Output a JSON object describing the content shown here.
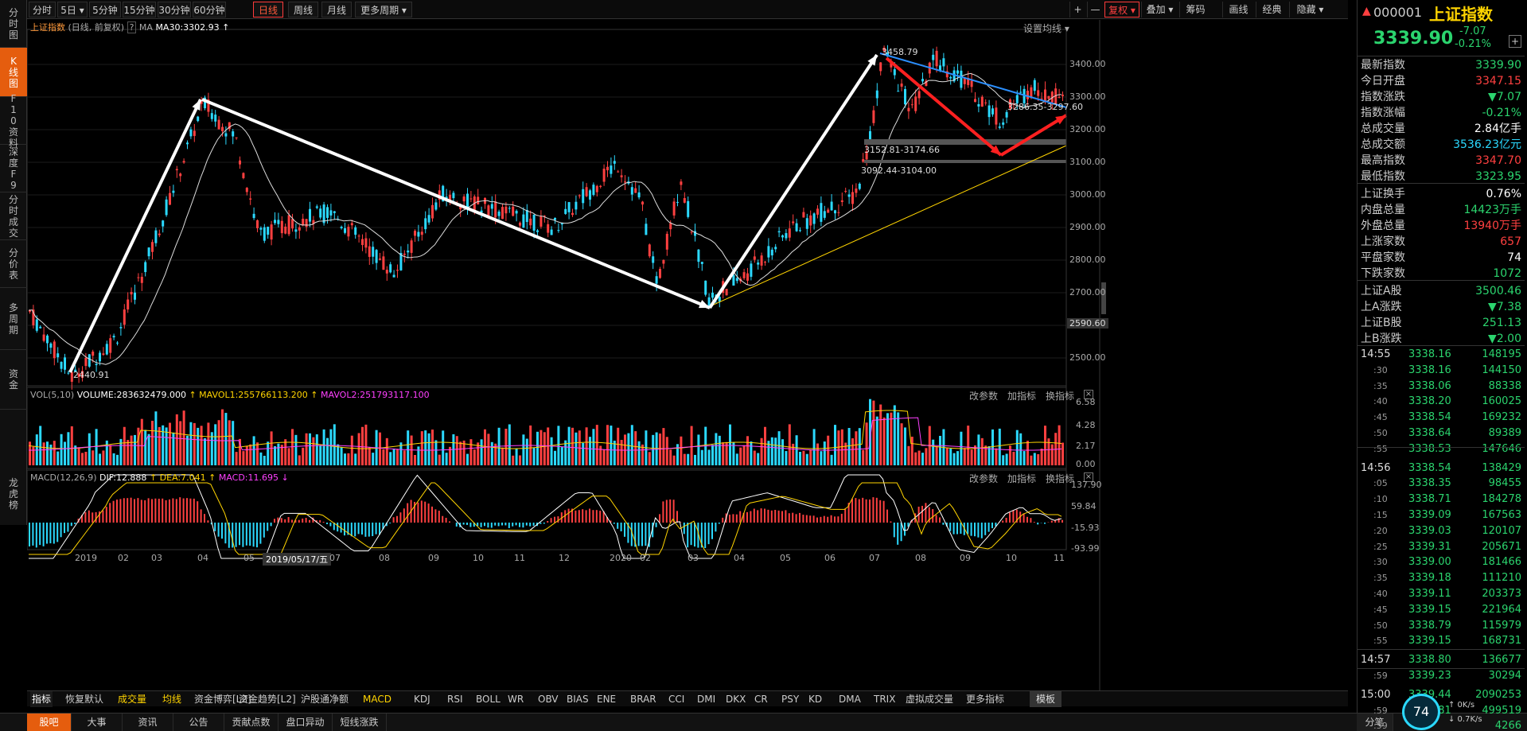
{
  "left_nav": [
    {
      "label": "分时图"
    },
    {
      "label": "K线图"
    },
    {
      "label": "F10资料"
    },
    {
      "label": "深度F9"
    },
    {
      "label": "分时成交"
    },
    {
      "label": "分价表"
    },
    {
      "label": "多周期"
    },
    {
      "label": "资金"
    },
    {
      "label": "龙虎榜"
    }
  ],
  "toolbar": {
    "periods": [
      "分时",
      "5日 ▾",
      "5分钟",
      "15分钟",
      "30分钟",
      "60分钟",
      "日线",
      "周线",
      "月线",
      "更多周期 ▾"
    ],
    "active_period": "日线",
    "right_tools": [
      "+",
      "—",
      "复权 ▾",
      "叠加 ▾",
      "筹码",
      "画线",
      "经典",
      "隐藏 ▾"
    ]
  },
  "chart_header": {
    "title": "上证指数",
    "subtitle": "(日线, 前复权)",
    "help": "?",
    "ma_label": "MA",
    "ma30": "MA30:3302.93",
    "ma_arrow": "↑",
    "settings": "设置均线 ▾"
  },
  "price_axis": [
    "3400.00",
    "3300.00",
    "3200.00",
    "3100.00",
    "3000.00",
    "2900.00",
    "2800.00",
    "2700.00",
    "2600.00",
    "2500.00"
  ],
  "price_tag": "2590.60",
  "annotations": {
    "high": "3458.79",
    "low": "2440.91",
    "box1": "3152.81-3174.66",
    "box2": "3092.44-3104.00",
    "box3": "3286.35-3297.60"
  },
  "vol": {
    "label": "VOL(5,10)",
    "volume": "VOLUME:283632479.000",
    "mavol1": "MAVOL1:255766113.200",
    "mavol2": "MAVOL2:251793117.100",
    "arrow": "↑",
    "axis": [
      "6.58",
      "4.28",
      "2.17",
      "0.00"
    ],
    "links": [
      "改参数",
      "加指标",
      "换指标"
    ]
  },
  "macd": {
    "label": "MACD(12,26,9)",
    "dif": "DIF:12.888",
    "dea": "DEA:7.041",
    "macd": "MACD:11.695",
    "arrow_up": "↑",
    "arrow_down": "↓",
    "axis": [
      "137.90",
      "59.84",
      "-15.93",
      "-93.99"
    ],
    "links": [
      "改参数",
      "加指标",
      "换指标"
    ]
  },
  "date_axis": {
    "labels": [
      "2019",
      "02",
      "03",
      "04",
      "05",
      "2019/05/17/五",
      "07",
      "08",
      "09",
      "10",
      "11",
      "12",
      "2020",
      "02",
      "03",
      "04",
      "05",
      "06",
      "07",
      "08",
      "09",
      "10",
      "11"
    ]
  },
  "indicator_tabs": [
    "指标",
    "恢复默认",
    "成交量",
    "均线",
    "资金博弈[L2]",
    "资金趋势[L2]",
    "沪股通净额",
    "MACD",
    "KDJ",
    "RSI",
    "BOLL",
    "WR",
    "OBV",
    "BIAS",
    "ENE",
    "BRAR",
    "CCI",
    "DMI",
    "DKX",
    "CR",
    "PSY",
    "KD",
    "DMA",
    "TRIX",
    "虚拟成交量",
    "更多指标",
    "模板"
  ],
  "bottom_tabs": [
    "股吧",
    "大事",
    "资讯",
    "公告",
    "贡献点数",
    "盘口异动",
    "短线涨跌"
  ],
  "quote": {
    "code": "000001",
    "name": "上证指数",
    "price": "3339.90",
    "change": "-7.07",
    "change_pct": "-0.21%",
    "add": "+",
    "rows": [
      {
        "label": "最新指数",
        "value": "3339.90",
        "color": "green"
      },
      {
        "label": "今日开盘",
        "value": "3347.15",
        "color": "red"
      },
      {
        "label": "指数涨跌",
        "value": "▼7.07",
        "color": "green"
      },
      {
        "label": "指数涨幅",
        "value": "-0.21%",
        "color": "green"
      },
      {
        "label": "总成交量",
        "value": "2.84亿手",
        "color": "white"
      },
      {
        "label": "总成交额",
        "value": "3536.23亿元",
        "color": "cyan"
      },
      {
        "label": "最高指数",
        "value": "3347.70",
        "color": "red"
      },
      {
        "label": "最低指数",
        "value": "3323.95",
        "color": "green"
      },
      {
        "label": "上证换手",
        "value": "0.76%",
        "color": "white"
      },
      {
        "label": "内盘总量",
        "value": "14423万手",
        "color": "green"
      },
      {
        "label": "外盘总量",
        "value": "13940万手",
        "color": "red"
      },
      {
        "label": "上涨家数",
        "value": "657",
        "color": "red"
      },
      {
        "label": "平盘家数",
        "value": "74",
        "color": "white"
      },
      {
        "label": "下跌家数",
        "value": "1072",
        "color": "green"
      },
      {
        "label": "上证A股",
        "value": "3500.46",
        "color": "green"
      },
      {
        "label": "上A涨跌",
        "value": "▼7.38",
        "color": "green"
      },
      {
        "label": "上证B股",
        "value": "251.13",
        "color": "green"
      },
      {
        "label": "上B涨跌",
        "value": "▼2.00",
        "color": "green"
      }
    ]
  },
  "ticks": [
    {
      "time": "14:55",
      "price": "3338.16",
      "vol": "148195"
    },
    {
      "time": ":30",
      "price": "3338.16",
      "vol": "144150"
    },
    {
      "time": ":35",
      "price": "3338.06",
      "vol": "88338"
    },
    {
      "time": ":40",
      "price": "3338.20",
      "vol": "160025"
    },
    {
      "time": ":45",
      "price": "3338.54",
      "vol": "169232"
    },
    {
      "time": ":50",
      "price": "3338.64",
      "vol": "89389"
    },
    {
      "time": ":55",
      "price": "3338.53",
      "vol": "147646"
    },
    {
      "time": "14:56",
      "price": "3338.54",
      "vol": "138429"
    },
    {
      "time": ":05",
      "price": "3338.35",
      "vol": "98455"
    },
    {
      "time": ":10",
      "price": "3338.71",
      "vol": "184278"
    },
    {
      "time": ":15",
      "price": "3339.09",
      "vol": "167563"
    },
    {
      "time": ":20",
      "price": "3339.03",
      "vol": "120107"
    },
    {
      "time": ":25",
      "price": "3339.31",
      "vol": "205671"
    },
    {
      "time": ":30",
      "price": "3339.00",
      "vol": "181466"
    },
    {
      "time": ":35",
      "price": "3339.18",
      "vol": "111210"
    },
    {
      "time": ":40",
      "price": "3339.11",
      "vol": "203373"
    },
    {
      "time": ":45",
      "price": "3339.15",
      "vol": "221964"
    },
    {
      "time": ":50",
      "price": "3338.79",
      "vol": "115979"
    },
    {
      "time": ":55",
      "price": "3339.15",
      "vol": "168731"
    },
    {
      "time": "14:57",
      "price": "3338.80",
      "vol": "136677"
    },
    {
      "time": ":59",
      "price": "3339.23",
      "vol": "30294"
    },
    {
      "time": "15:00",
      "price": "3339.44",
      "vol": "2090253"
    },
    {
      "time": ":59",
      "price": "3339.81",
      "vol": "499519"
    },
    {
      "time": ":59",
      "price": "",
      "vol": "4266"
    }
  ],
  "ticks_tab": "分笔",
  "gauge": "74",
  "speed": [
    "↑ 0K/s",
    "↓ 0.7K/s"
  ],
  "colors": {
    "up": "#ff4040",
    "down": "#2bd9ff",
    "accent": "#e55d0e",
    "ma": "#ffffff"
  }
}
